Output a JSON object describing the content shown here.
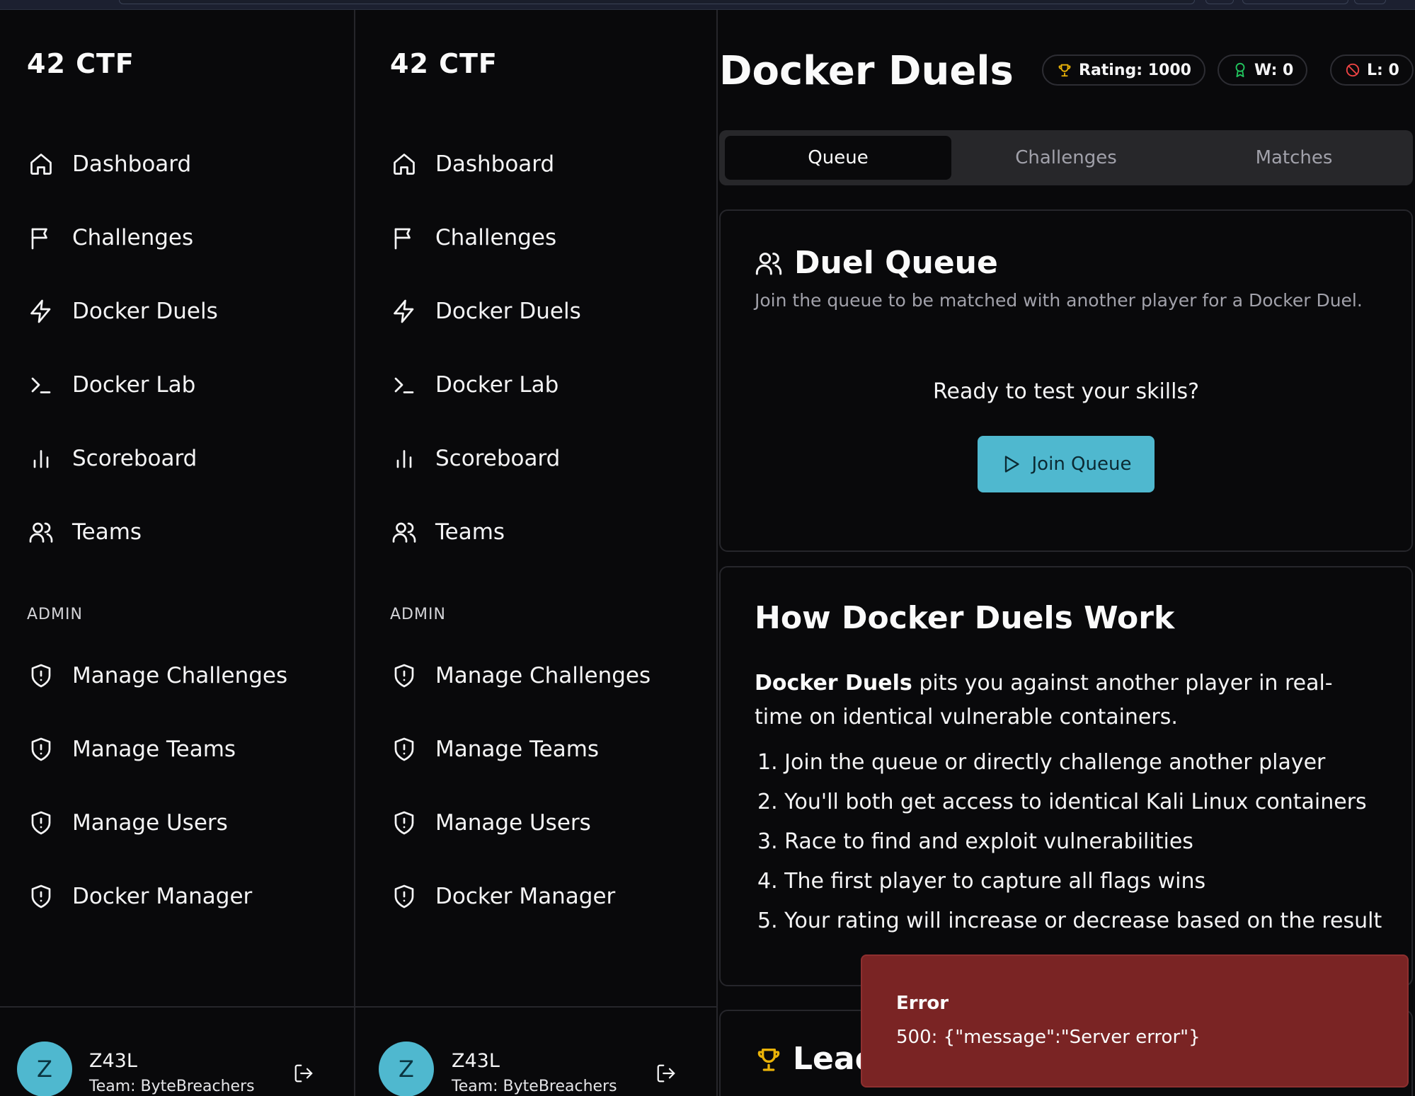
{
  "brand": "42 CTF",
  "nav": {
    "items": [
      {
        "label": "Dashboard",
        "icon": "home-icon"
      },
      {
        "label": "Challenges",
        "icon": "flag-icon"
      },
      {
        "label": "Docker Duels",
        "icon": "zap-icon"
      },
      {
        "label": "Docker Lab",
        "icon": "terminal-icon"
      },
      {
        "label": "Scoreboard",
        "icon": "bar-chart-icon"
      },
      {
        "label": "Teams",
        "icon": "users-icon"
      }
    ],
    "admin_label": "ADMIN",
    "admin_items": [
      {
        "label": "Manage Challenges",
        "icon": "shield-alert-icon"
      },
      {
        "label": "Manage Teams",
        "icon": "shield-alert-icon"
      },
      {
        "label": "Manage Users",
        "icon": "shield-alert-icon"
      },
      {
        "label": "Docker Manager",
        "icon": "shield-alert-icon"
      }
    ]
  },
  "user": {
    "initial": "Z",
    "name": "Z43L",
    "team": "Team: ByteBreachers"
  },
  "page": {
    "title": "Docker Duels",
    "stats": {
      "rating": "Rating: 1000",
      "wins": "W: 0",
      "losses": "L: 0"
    },
    "tabs": [
      {
        "label": "Queue",
        "active": true
      },
      {
        "label": "Challenges",
        "active": false
      },
      {
        "label": "Matches",
        "active": false
      }
    ]
  },
  "queue_card": {
    "title": "Duel Queue",
    "description": "Join the queue to be matched with another player for a Docker Duel.",
    "prompt": "Ready to test your skills?",
    "button": "Join Queue"
  },
  "how_card": {
    "title": "How Docker Duels Work",
    "intro_bold": "Docker Duels",
    "intro_rest": " pits you against another player in real-time on identical vulnerable containers.",
    "steps": [
      "1. Join the queue or directly challenge another player",
      "2. You'll both get access to identical Kali Linux containers",
      "3. Race to find and exploit vulnerabilities",
      "4. The first player to capture all flags wins",
      "5. Your rating will increase or decrease based on the result"
    ]
  },
  "leaderboard_card": {
    "title": "Lead"
  },
  "toast": {
    "title": "Error",
    "message": "500: {\"message\":\"Server error\"}"
  },
  "colors": {
    "background": "#09090b",
    "accent": "#4fb8cf",
    "rating_icon": "#eab308",
    "win_icon": "#22c55e",
    "loss_icon": "#ef4444",
    "error_toast": "#7a2424"
  }
}
